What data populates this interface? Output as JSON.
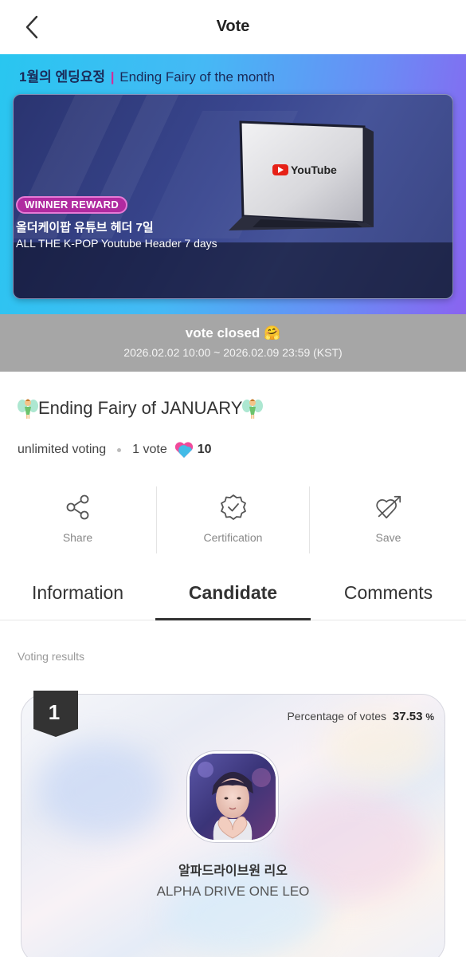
{
  "header": {
    "title": "Vote"
  },
  "banner": {
    "title_ko": "1월의 엔딩요정",
    "separator": "|",
    "title_en": "Ending Fairy of the month",
    "laptop_brand": "YouTube",
    "reward_badge": "WINNER REWARD",
    "reward_ko": "올더케이팝 유튜브 헤더 7일",
    "reward_en": "ALL THE K-POP Youtube Header 7 days"
  },
  "status": {
    "title": "vote closed 🤗",
    "dates": "2026.02.02 10:00 ~ 2026.02.09 23:59 (KST)"
  },
  "vote": {
    "title": "Ending Fairy of JANUARY",
    "voting_type": "unlimited voting",
    "per_vote": "1 vote",
    "heart_count": "10"
  },
  "actions": [
    {
      "label": "Share",
      "icon": "share-icon"
    },
    {
      "label": "Certification",
      "icon": "certification-icon"
    },
    {
      "label": "Save",
      "icon": "heart-arrow-icon"
    }
  ],
  "tabs": [
    {
      "label": "Information",
      "active": false
    },
    {
      "label": "Candidate",
      "active": true
    },
    {
      "label": "Comments",
      "active": false
    }
  ],
  "results": {
    "label": "Voting results",
    "candidates": [
      {
        "rank": "1",
        "pct_label": "Percentage of votes",
        "pct_value": "37.53",
        "pct_unit": "%",
        "name_ko": "알파드라이브원 리오",
        "name_en": "ALPHA DRIVE ONE LEO"
      }
    ]
  },
  "colors": {
    "banner_gradient_start": "#29c6f0",
    "banner_gradient_end": "#8a63f0",
    "reward_badge": "#b02aa0",
    "closed_bar": "#a6a6a6",
    "heart_pink": "#f04a9a",
    "heart_blue": "#2fc8f0"
  }
}
